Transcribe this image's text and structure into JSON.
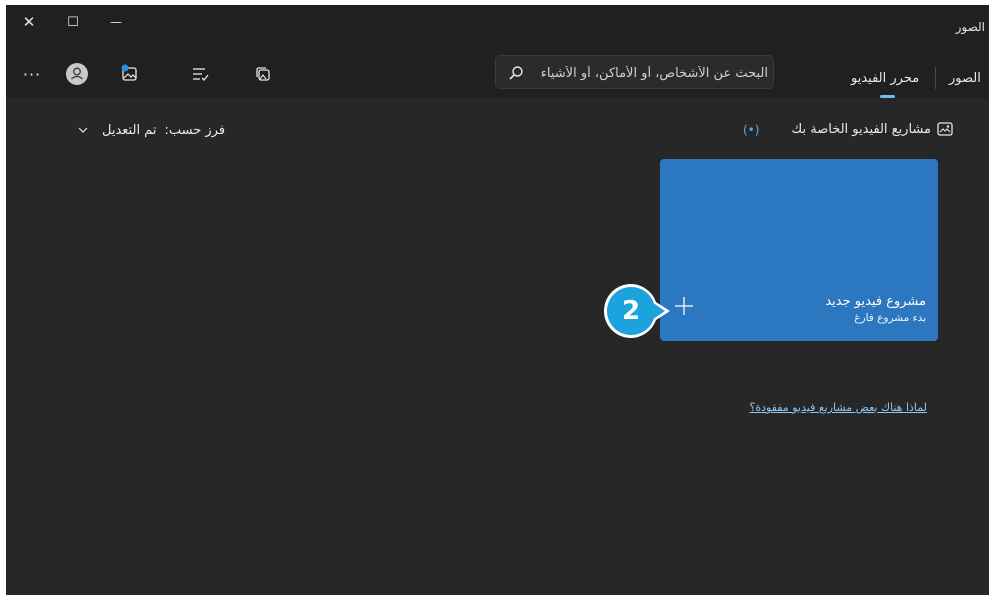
{
  "app": {
    "title": "الصور"
  },
  "window_controls": {
    "close": "✕",
    "maximize": "☐",
    "minimize": "—"
  },
  "nav": {
    "tabs": [
      {
        "label": "الصور"
      },
      {
        "label": "محرر الفيديو"
      }
    ],
    "active": "محرر الفيديو"
  },
  "search": {
    "placeholder": "البحث عن الأشخاص، أو الأماكن، أو الأشياء",
    "value": ""
  },
  "toolbar": {
    "more": "···"
  },
  "section": {
    "title": "مشاريع الفيديو الخاصة بك",
    "sort_label": "فرز حسب:",
    "sort_value": "تم التعديل"
  },
  "new_project_card": {
    "title": "مشروع فيديو جديد",
    "subtitle": "بدء مشروع فارغ"
  },
  "missing_link": "لماذا هناك بعض مشاريع فيديو مفقودة؟",
  "callout": {
    "number": "2"
  },
  "colors": {
    "accent": "#2b77c0",
    "callout": "#1aa3dc",
    "link": "#8ec7f3"
  }
}
